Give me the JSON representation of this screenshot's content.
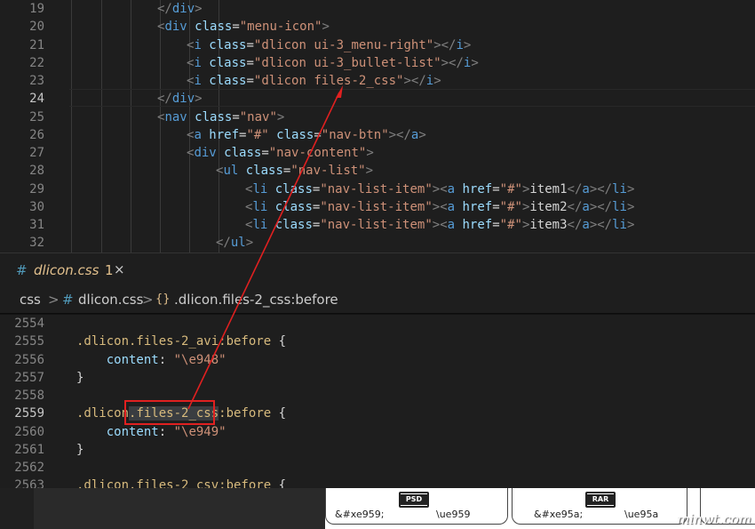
{
  "editor_top": {
    "lines": [
      {
        "n": "19",
        "code": [
          [
            "p",
            "</"
          ],
          [
            "t",
            "div"
          ],
          [
            "p",
            ">"
          ]
        ]
      },
      {
        "n": "20",
        "code": [
          [
            "p",
            "<"
          ],
          [
            "t",
            "div "
          ],
          [
            "a",
            "class"
          ],
          [
            "w",
            "="
          ],
          [
            "s",
            "\"menu-icon\""
          ],
          [
            "p",
            ">"
          ]
        ]
      },
      {
        "n": "21",
        "code": [
          [
            "p",
            "<"
          ],
          [
            "t",
            "i "
          ],
          [
            "a",
            "class"
          ],
          [
            "w",
            "="
          ],
          [
            "s",
            "\"dlicon ui-3_menu-right\""
          ],
          [
            "p",
            "></"
          ],
          [
            "t",
            "i"
          ],
          [
            "p",
            ">"
          ]
        ]
      },
      {
        "n": "22",
        "code": [
          [
            "p",
            "<"
          ],
          [
            "t",
            "i "
          ],
          [
            "a",
            "class"
          ],
          [
            "w",
            "="
          ],
          [
            "s",
            "\"dlicon ui-3_bullet-list\""
          ],
          [
            "p",
            "></"
          ],
          [
            "t",
            "i"
          ],
          [
            "p",
            ">"
          ]
        ]
      },
      {
        "n": "23",
        "code": [
          [
            "p",
            "<"
          ],
          [
            "t",
            "i "
          ],
          [
            "a",
            "class"
          ],
          [
            "w",
            "="
          ],
          [
            "s",
            "\"dlicon files-2_css\""
          ],
          [
            "p",
            "></"
          ],
          [
            "t",
            "i"
          ],
          [
            "p",
            ">"
          ]
        ]
      },
      {
        "n": "24",
        "code": [
          [
            "p",
            "</"
          ],
          [
            "t",
            "div"
          ],
          [
            "p",
            ">"
          ]
        ]
      },
      {
        "n": "25",
        "code": [
          [
            "p",
            "<"
          ],
          [
            "t",
            "nav "
          ],
          [
            "a",
            "class"
          ],
          [
            "w",
            "="
          ],
          [
            "s",
            "\"nav\""
          ],
          [
            "p",
            ">"
          ]
        ]
      },
      {
        "n": "26",
        "code": [
          [
            "p",
            "<"
          ],
          [
            "t",
            "a "
          ],
          [
            "a",
            "href"
          ],
          [
            "w",
            "="
          ],
          [
            "s",
            "\"#\" "
          ],
          [
            "a",
            "class"
          ],
          [
            "w",
            "="
          ],
          [
            "s",
            "\"nav-btn\""
          ],
          [
            "p",
            "></"
          ],
          [
            "t",
            "a"
          ],
          [
            "p",
            ">"
          ]
        ]
      },
      {
        "n": "27",
        "code": [
          [
            "p",
            "<"
          ],
          [
            "t",
            "div "
          ],
          [
            "a",
            "class"
          ],
          [
            "w",
            "="
          ],
          [
            "s",
            "\"nav-content\""
          ],
          [
            "p",
            ">"
          ]
        ]
      },
      {
        "n": "28",
        "code": [
          [
            "p",
            "<"
          ],
          [
            "t",
            "ul "
          ],
          [
            "a",
            "class"
          ],
          [
            "w",
            "="
          ],
          [
            "s",
            "\"nav-list\""
          ],
          [
            "p",
            ">"
          ]
        ]
      },
      {
        "n": "29",
        "code": [
          [
            "p",
            "<"
          ],
          [
            "t",
            "li "
          ],
          [
            "a",
            "class"
          ],
          [
            "w",
            "="
          ],
          [
            "s",
            "\"nav-list-item\""
          ],
          [
            "p",
            "><"
          ],
          [
            "t",
            "a "
          ],
          [
            "a",
            "href"
          ],
          [
            "w",
            "="
          ],
          [
            "s",
            "\"#\""
          ],
          [
            "p",
            ">"
          ],
          [
            "w",
            "item1"
          ],
          [
            "p",
            "</"
          ],
          [
            "t",
            "a"
          ],
          [
            "p",
            "></"
          ],
          [
            "t",
            "li"
          ],
          [
            "p",
            ">"
          ]
        ]
      },
      {
        "n": "30",
        "code": [
          [
            "p",
            "<"
          ],
          [
            "t",
            "li "
          ],
          [
            "a",
            "class"
          ],
          [
            "w",
            "="
          ],
          [
            "s",
            "\"nav-list-item\""
          ],
          [
            "p",
            "><"
          ],
          [
            "t",
            "a "
          ],
          [
            "a",
            "href"
          ],
          [
            "w",
            "="
          ],
          [
            "s",
            "\"#\""
          ],
          [
            "p",
            ">"
          ],
          [
            "w",
            "item2"
          ],
          [
            "p",
            "</"
          ],
          [
            "t",
            "a"
          ],
          [
            "p",
            "></"
          ],
          [
            "t",
            "li"
          ],
          [
            "p",
            ">"
          ]
        ]
      },
      {
        "n": "31",
        "code": [
          [
            "p",
            "<"
          ],
          [
            "t",
            "li "
          ],
          [
            "a",
            "class"
          ],
          [
            "w",
            "="
          ],
          [
            "s",
            "\"nav-list-item\""
          ],
          [
            "p",
            "><"
          ],
          [
            "t",
            "a "
          ],
          [
            "a",
            "href"
          ],
          [
            "w",
            "="
          ],
          [
            "s",
            "\"#\""
          ],
          [
            "p",
            ">"
          ],
          [
            "w",
            "item3"
          ],
          [
            "p",
            "</"
          ],
          [
            "t",
            "a"
          ],
          [
            "p",
            "></"
          ],
          [
            "t",
            "li"
          ],
          [
            "p",
            ">"
          ]
        ]
      },
      {
        "n": "32",
        "code": [
          [
            "p",
            "</"
          ],
          [
            "t",
            "ul"
          ],
          [
            "p",
            ">"
          ]
        ]
      }
    ]
  },
  "tab": {
    "hash": "#",
    "name": "dlicon.css",
    "modified": "1",
    "close": "×"
  },
  "breadcrumb": {
    "part1": "css",
    "sep1": ">",
    "hash": "#",
    "part2": "dlicon.css",
    "sep2": ">",
    "symbol_icon": "{}",
    "part3": ".dlicon.files-2_css:before"
  },
  "editor_bottom": {
    "lines": [
      {
        "n": "2554",
        "code": []
      },
      {
        "n": "2555",
        "code": [
          [
            "sel",
            ".dlicon.files-2_avi:before"
          ],
          [
            "w",
            " {"
          ]
        ]
      },
      {
        "n": "2556",
        "code": [
          [
            "w",
            "    "
          ],
          [
            "k",
            "content"
          ],
          [
            "w",
            ": "
          ],
          [
            "s",
            "\"\\e948\""
          ]
        ]
      },
      {
        "n": "2557",
        "code": [
          [
            "w",
            "}"
          ]
        ]
      },
      {
        "n": "2558",
        "code": []
      },
      {
        "n": "2559",
        "code": [
          [
            "sel",
            ".dlicon"
          ],
          [
            "hl",
            ".files-2_css"
          ],
          [
            "sel",
            ":before"
          ],
          [
            "w",
            " {"
          ]
        ]
      },
      {
        "n": "2560",
        "code": [
          [
            "w",
            "    "
          ],
          [
            "k",
            "content"
          ],
          [
            "w",
            ": "
          ],
          [
            "s",
            "\"\\e949\""
          ]
        ]
      },
      {
        "n": "2561",
        "code": [
          [
            "w",
            "}"
          ]
        ]
      },
      {
        "n": "2562",
        "code": []
      },
      {
        "n": "2563",
        "code": [
          [
            "sel",
            ".dlicon.files-2_csv:before"
          ],
          [
            "w",
            " {"
          ]
        ]
      }
    ]
  },
  "bottom_cards": [
    {
      "icon": "PSD",
      "entity": "&#xe959;",
      "code": "\\ue959"
    },
    {
      "icon": "RAR",
      "entity": "&#xe95a;",
      "code": "\\ue95a"
    }
  ],
  "watermark": "minwt.com",
  "colors": {
    "tag": "#569cd6",
    "attr": "#9cdcfe",
    "string": "#ce9178",
    "punct": "#808080",
    "selector": "#d7ba7d",
    "annotation": "#e02020"
  }
}
